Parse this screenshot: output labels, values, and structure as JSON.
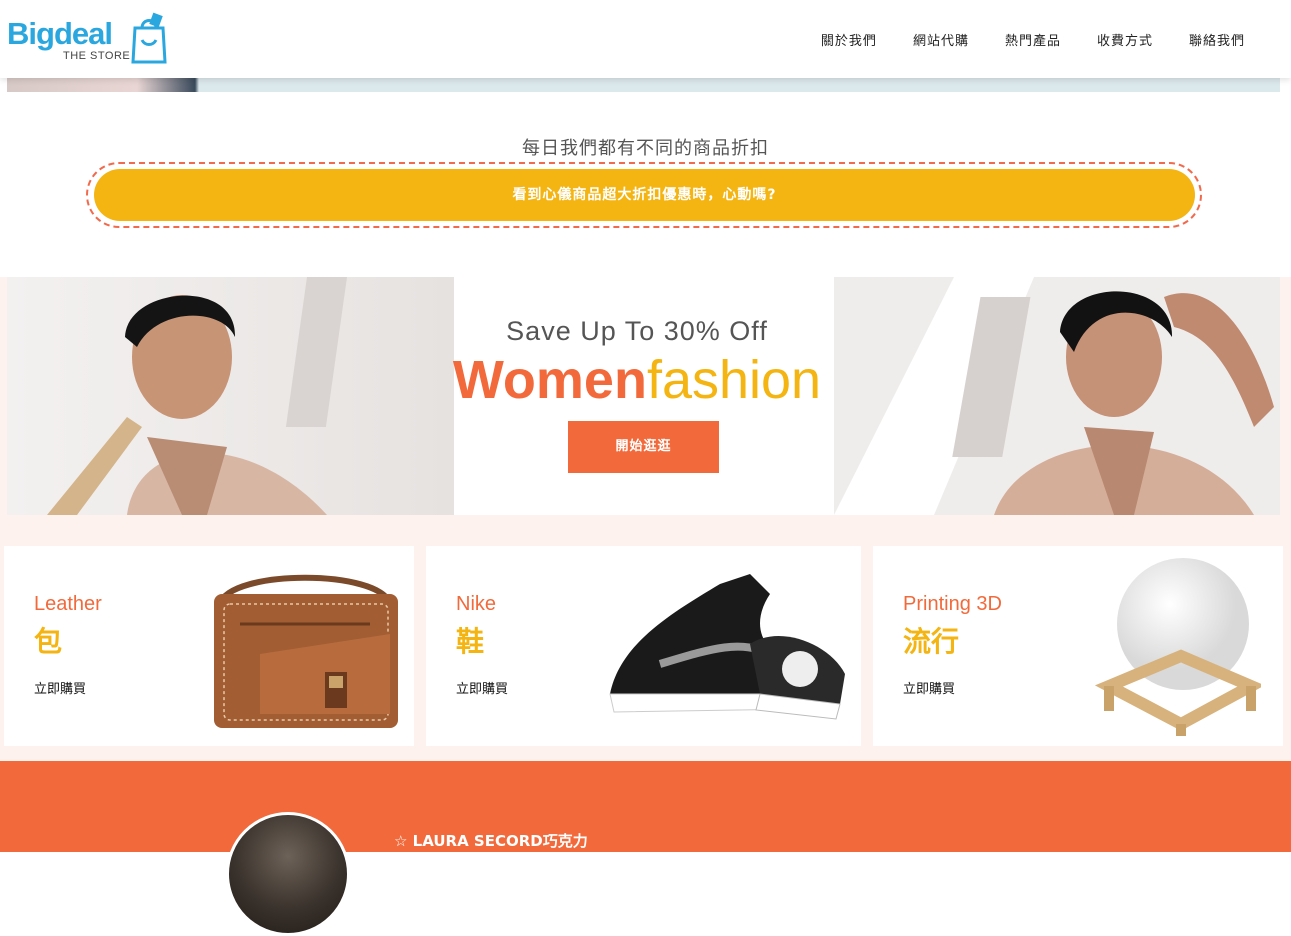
{
  "logo": {
    "brand_part1": "Big",
    "brand_part2": "deal",
    "tagline": "THE STORE"
  },
  "nav": [
    {
      "label": "關於我們"
    },
    {
      "label": "網站代購"
    },
    {
      "label": "熱門產品"
    },
    {
      "label": "收費方式"
    },
    {
      "label": "聯絡我們"
    }
  ],
  "promo": {
    "title": "每日我們都有不同的商品折扣",
    "button": "看到心儀商品超大折扣優惠時，心動嗎?"
  },
  "hero": {
    "subtitle": "Save Up To 30% Off",
    "title_part1": "Women",
    "title_part2": "fashion",
    "button": "開始逛逛"
  },
  "cards": [
    {
      "en": "Leather",
      "zh": "包",
      "buy": "立即購買"
    },
    {
      "en": "Nike",
      "zh": "鞋",
      "buy": "立即購買"
    },
    {
      "en": "Printing 3D",
      "zh": "流行",
      "buy": "立即購買"
    }
  ],
  "testimonial": {
    "title": "☆ LAURA SECORD巧克力"
  },
  "colors": {
    "accent_orange": "#f26a3b",
    "accent_yellow": "#f4b412",
    "brand_blue": "#2aa7df"
  }
}
